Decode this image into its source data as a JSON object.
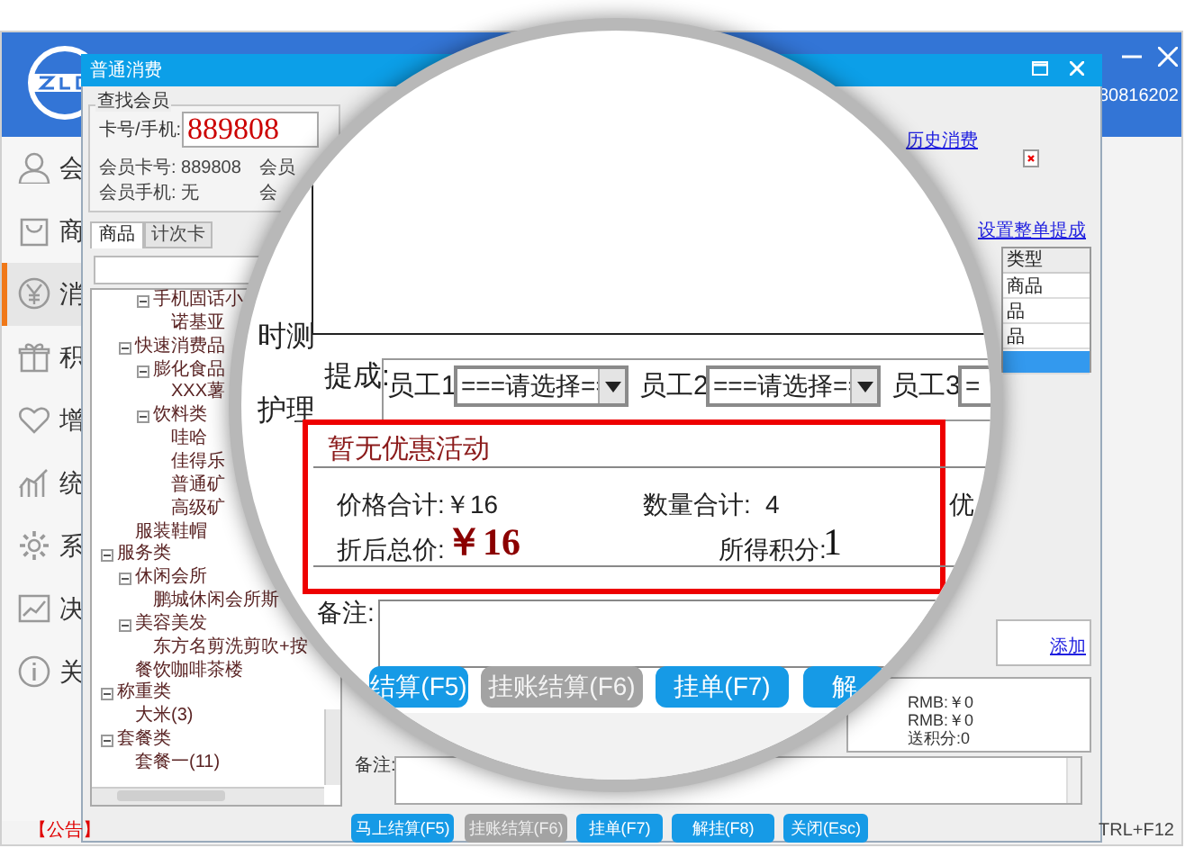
{
  "app": {
    "header_text": "80816202",
    "sidebar": [
      {
        "label": "会",
        "selected": false
      },
      {
        "label": "商",
        "selected": false
      },
      {
        "label": "消",
        "selected": true
      },
      {
        "label": "积",
        "selected": false
      },
      {
        "label": "增",
        "selected": false
      },
      {
        "label": "统",
        "selected": false
      },
      {
        "label": "系",
        "selected": false
      },
      {
        "label": "决",
        "selected": false
      },
      {
        "label": "关",
        "selected": false
      }
    ],
    "notice": "【公告】",
    "shortcut": "TRL+F12"
  },
  "dialog": {
    "title": "普通消费",
    "member_search": {
      "legend": "查找会员",
      "card_label": "卡号/手机:",
      "card_value": "889808",
      "fields": [
        "会员卡号: 889808",
        "会员手机: 无"
      ],
      "column_2": [
        "会员",
        "会"
      ]
    },
    "history_link": "历史消费",
    "tabs": [
      {
        "label": "商品",
        "selected": true
      },
      {
        "label": "计次卡",
        "selected": false
      }
    ],
    "tree": [
      {
        "children": [
          {
            "children": [
              {
                "label": "手机固话小",
                "expanded": true,
                "children": [
                  {
                    "label": "诺基亚"
                  }
                ]
              }
            ]
          },
          {
            "label": "快速消费品",
            "expanded": true,
            "children": [
              {
                "label": "膨化食品",
                "expanded": true,
                "children": [
                  {
                    "label": "XXX薯"
                  }
                ]
              },
              {
                "label": "饮料类",
                "expanded": true,
                "children": [
                  {
                    "label": "哇哈"
                  },
                  {
                    "label": "佳得乐"
                  },
                  {
                    "label": "普通矿"
                  },
                  {
                    "label": "高级矿"
                  }
                ]
              }
            ]
          },
          {
            "label": "服装鞋帽"
          }
        ]
      },
      {
        "label": "服务类",
        "expanded": true,
        "children": [
          {
            "label": "休闲会所",
            "expanded": true,
            "children": [
              {
                "label": "鹏城休闲会所斯"
              }
            ]
          },
          {
            "label": "美容美发",
            "expanded": true,
            "children": [
              {
                "label": "东方名剪洗剪吹+按"
              }
            ]
          },
          {
            "label": "餐饮咖啡茶楼"
          }
        ]
      },
      {
        "label": "称重类",
        "expanded": true,
        "children": [
          {
            "label": "大米(3)"
          }
        ]
      },
      {
        "label": "套餐类",
        "expanded": true,
        "children": [
          {
            "label": "套餐一(11)"
          }
        ]
      }
    ],
    "commission_link": "设置整单提成",
    "table": {
      "header": "类型",
      "rows": [
        {
          "text": "商品",
          "selected": false
        },
        {
          "text": "品",
          "selected": false
        },
        {
          "text": "品",
          "selected": false
        },
        {
          "selected": true
        }
      ]
    },
    "add_link": "添加",
    "summary": [
      "RMB:￥0",
      "RMB:￥0",
      "送积分:0"
    ],
    "note_label": "备注:",
    "buttons": [
      {
        "label": "马上结算(F5)",
        "disabled": false
      },
      {
        "label": "挂账结算(F6)",
        "disabled": true
      },
      {
        "label": "挂单(F7)",
        "disabled": false
      },
      {
        "label": "解挂(F8)",
        "disabled": false
      },
      {
        "label": "关闭(Esc)",
        "disabled": false
      }
    ]
  },
  "magnifier": {
    "side_labels": [
      "时测",
      "护理"
    ],
    "commission_label": "提成:",
    "staff": [
      {
        "label": "员工1",
        "select": "===请选择=="
      },
      {
        "label": "员工2",
        "select": "===请选择=="
      },
      {
        "label": "员工3",
        "select": "="
      }
    ],
    "promo": "暂无优惠活动",
    "price_total_label": "价格合计:",
    "price_total": "￥16",
    "qty_label": "数量合计:",
    "qty": "4",
    "cut_label": "优",
    "discount_label": "折后总价:",
    "discount": "￥16",
    "points_label": "所得积分:",
    "points": "1",
    "note_label": "备注:",
    "buttons": [
      {
        "label": "结算(F5)",
        "disabled": false
      },
      {
        "label": "挂账结算(F6)",
        "disabled": true
      },
      {
        "label": "挂单(F7)",
        "disabled": false
      },
      {
        "label": "解",
        "disabled": false
      }
    ]
  }
}
